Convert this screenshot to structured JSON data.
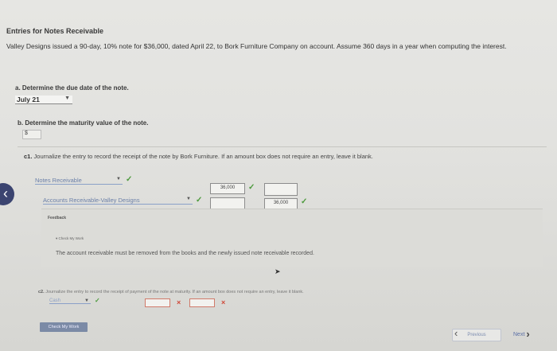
{
  "title": "Entries for Notes Receivable",
  "statement": "Valley Designs issued a 90-day, 10% note for $36,000, dated April 22, to Bork Furniture Company on account. Assume 360 days in a year when computing the interest.",
  "part_a": {
    "question": "a. Determine the due date of the note.",
    "selected": "July 21"
  },
  "part_b": {
    "question": "b. Determine the maturity value of the note.",
    "currency": "$"
  },
  "part_c1": {
    "label": "c1.",
    "question": "Journalize the entry to record the receipt of the note by Bork Furniture. If an amount box does not require an entry, leave it blank.",
    "rows": [
      {
        "account": "Notes Receivable",
        "debit": "36,000",
        "credit": ""
      },
      {
        "account": "Accounts Receivable-Valley Designs",
        "debit": "",
        "credit": "36,000"
      }
    ]
  },
  "feedback": {
    "label": "Feedback",
    "check_my_work": "Check My Work",
    "text": "The account receivable must be removed from the books and the newly issued note receivable recorded."
  },
  "part_c2": {
    "label": "c2.",
    "question": "Journalize the entry to record the receipt of payment of the note at maturity. If an amount box does not require an entry, leave it blank.",
    "account": "Cash"
  },
  "buttons": {
    "check_my_work": "Check My Work",
    "previous": "Previous",
    "next": "Next"
  },
  "colors": {
    "correct": "#4c9a3c",
    "incorrect": "#d04a3a",
    "link": "#6a7fa8"
  }
}
